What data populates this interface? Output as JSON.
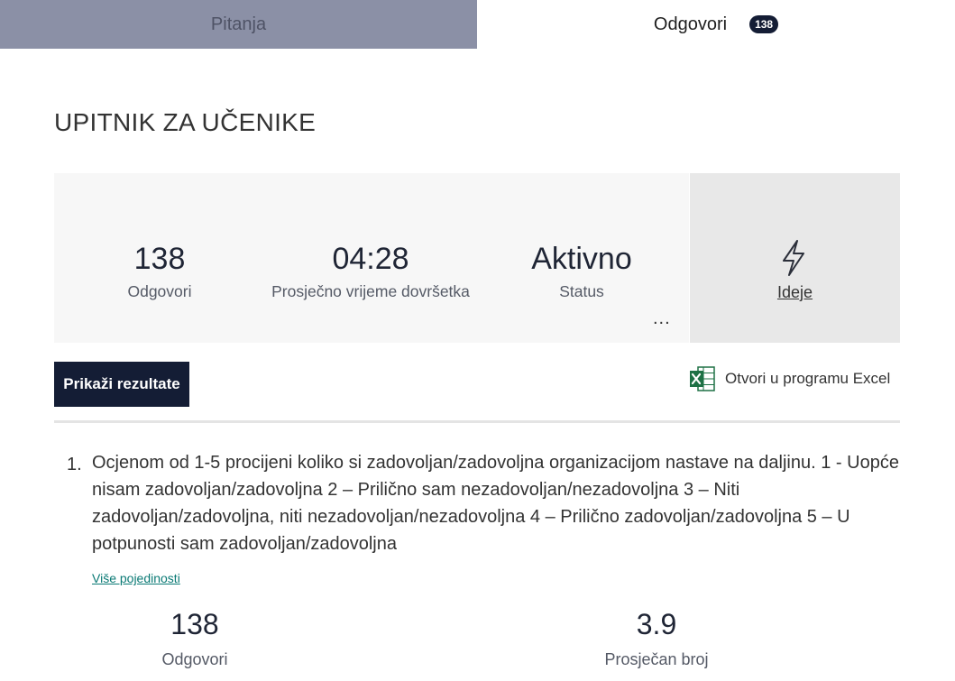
{
  "tabs": {
    "questions": "Pitanja",
    "responses": "Odgovori",
    "responses_count": "138"
  },
  "form": {
    "title": "UPITNIK ZA UČENIKE"
  },
  "summary": {
    "responses_value": "138",
    "responses_label": "Odgovori",
    "avg_time_value": "04:28",
    "avg_time_label": "Prosječno vrijeme dovršetka",
    "status_value": "Aktivno",
    "status_label": "Status",
    "more": "..."
  },
  "ideas": {
    "label": "Ideje",
    "icon": "lightning-icon"
  },
  "actions": {
    "show_results": "Prikaži rezultate",
    "open_excel": "Otvori u programu Excel",
    "excel_icon": "excel-icon",
    "excel_color": "#1e7145"
  },
  "question": {
    "number": "1.",
    "text": "Ocjenom od 1-5 procijeni koliko si zadovoljan/zadovoljna organizacijom nastave na daljinu. 1 - Uopće nisam zadovoljan/zadovoljna 2 – Prilično sam nezadovoljan/nezadovoljna 3 – Niti zadovoljan/zadovoljna, niti nezadovoljan/nezadovoljna 4 – Prilično zadovoljan/zadovoljna 5 – U potpunosti sam zadovoljan/zadovoljna",
    "more_details": "Više pojedinosti",
    "responses_value": "138",
    "responses_label": "Odgovori",
    "average_value": "3.9",
    "average_label": "Prosječan broj"
  },
  "colors": {
    "accent_dark": "#141d35",
    "tab_inactive": "#8b90a6",
    "link_teal": "#0b7a75"
  }
}
